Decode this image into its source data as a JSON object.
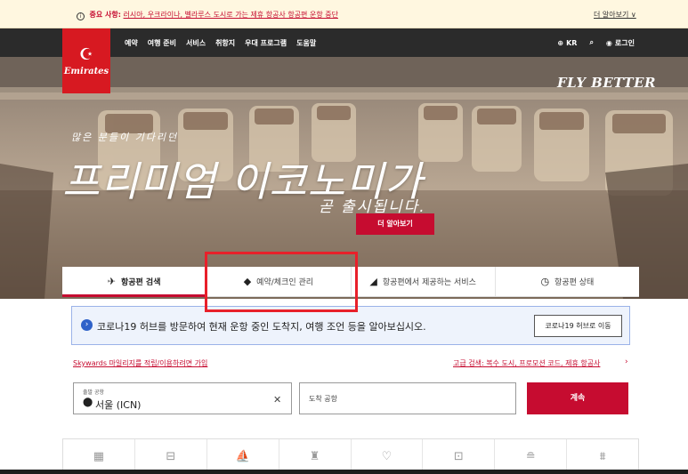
{
  "notice": {
    "label": "중요 사항:",
    "text": "러시아, 우크라이나, 벨라루스 도시로 가는 제휴 항공사 항공편 운항 중단",
    "more": "더 알아보기 ∨"
  },
  "nav": {
    "logo_text": "Emirates",
    "links": [
      "예약",
      "여행 준비",
      "서비스",
      "취항지",
      "우대 프로그램",
      "도움말"
    ],
    "region": "KR",
    "login": "로그인"
  },
  "hero": {
    "tagline": "FLY BETTER",
    "subtitle": "많은 분들이 기다리던",
    "title": "프리미엄 이코노미가",
    "title2": "곧 출시됩니다.",
    "button": "더 알아보기"
  },
  "tabs": [
    {
      "label": "항공편 검색",
      "icon": "plane-icon",
      "active": true
    },
    {
      "label": "예약/체크인 관리",
      "icon": "tag-icon",
      "active": false
    },
    {
      "label": "항공편에서 제공하는 서비스",
      "icon": "seat-icon",
      "active": false
    },
    {
      "label": "항공편 상태",
      "icon": "clock-icon",
      "active": false
    }
  ],
  "covid": {
    "text": "코로나19 허브를 방문하여 현재 운항 중인 도착지, 여행 조언 등을 알아보십시오.",
    "button": "코로나19 허브로 이동"
  },
  "search": {
    "skywards_link": "Skywards 마일리지를 적립/이용하려면 가입",
    "advanced_link": "고급 검색: 복수 도시, 프로모션 코드, 제휴 항공사",
    "from_label": "출발 공항",
    "from_value": "서울 (ICN)",
    "to_placeholder": "도착 공항",
    "continue": "계속"
  },
  "service_icons": [
    "hotel-icon",
    "car-icon",
    "tour-icon",
    "chauffeur-icon",
    "insurance-icon",
    "transfer-icon",
    "lounge-icon",
    "city-icon"
  ]
}
